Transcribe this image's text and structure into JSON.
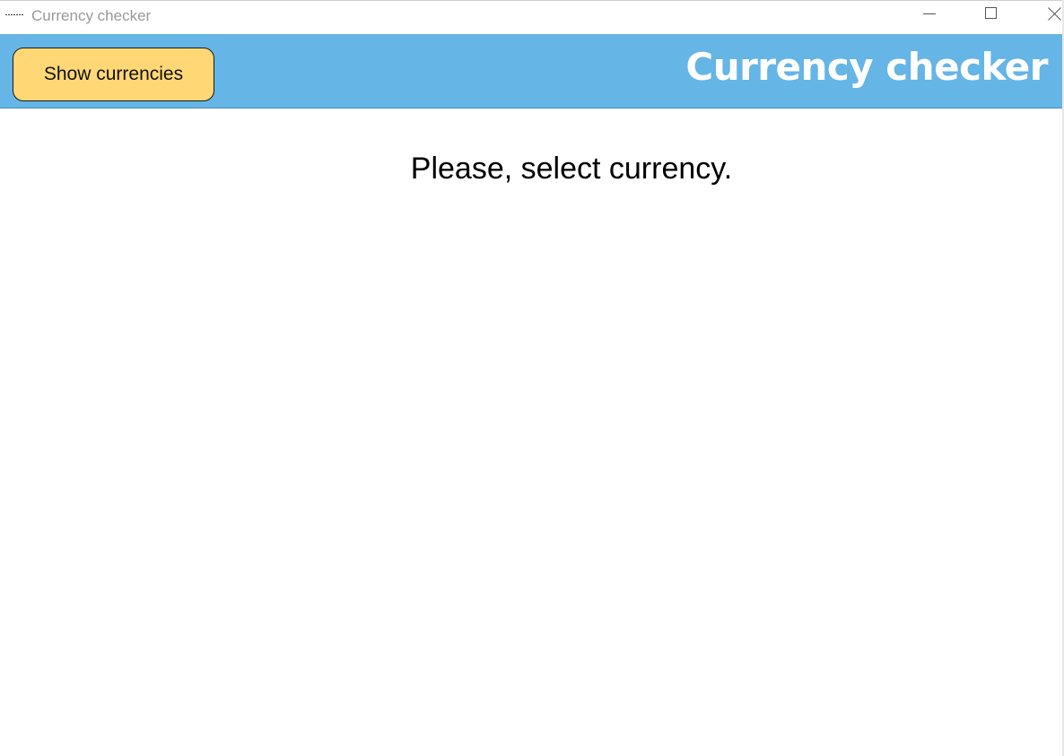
{
  "window": {
    "title": "Currency checker",
    "controls": {
      "minimize": "minimize-icon",
      "maximize": "maximize-icon",
      "close": "close-icon"
    }
  },
  "header": {
    "button_label": "Show currencies",
    "title": "Currency checker",
    "background_color": "#65b5e6",
    "button_color": "#ffd875"
  },
  "main": {
    "prompt": "Please, select currency."
  }
}
